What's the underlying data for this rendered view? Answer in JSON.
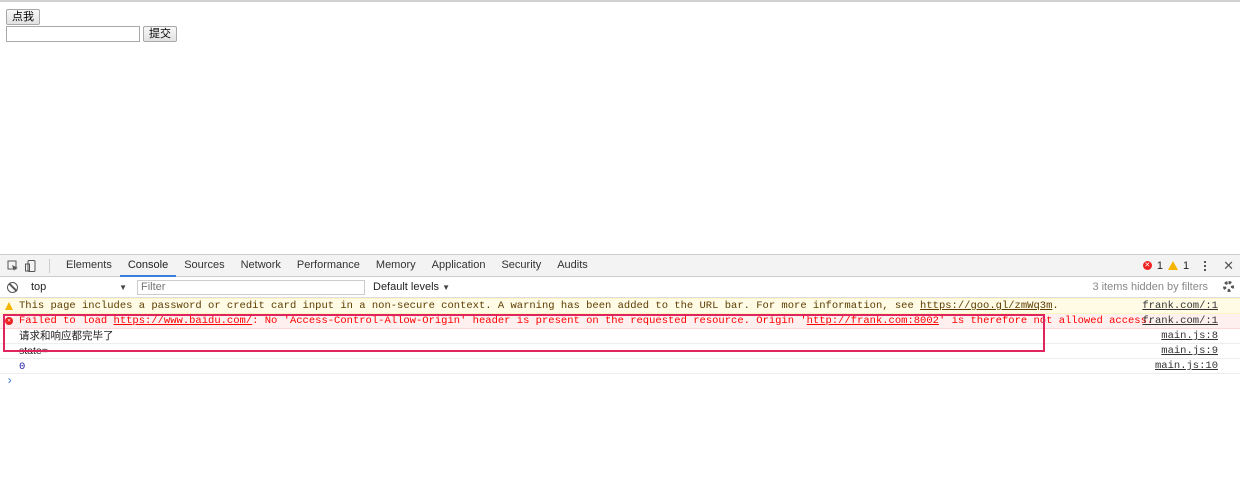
{
  "page": {
    "click_button": "点我",
    "text_input_value": "",
    "submit_button": "提交"
  },
  "devtools": {
    "tabs": [
      "Elements",
      "Console",
      "Sources",
      "Network",
      "Performance",
      "Memory",
      "Application",
      "Security",
      "Audits"
    ],
    "active_tab": "Console",
    "error_count": "1",
    "warning_count": "1",
    "context": "top",
    "filter_placeholder": "Filter",
    "levels": "Default levels",
    "hidden_note": "3 items hidden by filters"
  },
  "console": {
    "warn": {
      "text_before": "This page includes a password or credit card input in a non-secure context. A warning has been added to the URL bar. For more information, see ",
      "link": "https://goo.gl/zmWq3m",
      "text_after": ".",
      "source": "frank.com/:1"
    },
    "error": {
      "text1": "Failed to load ",
      "link1": "https://www.baidu.com/",
      "text2": ": No 'Access-Control-Allow-Origin' header is present on the requested resource. Origin '",
      "link2": "http://frank.com:8002",
      "text3": "' is therefore not allowed access.",
      "source": "frank.com/:1"
    },
    "log1": {
      "text": "请求和响应都完毕了",
      "source": "main.js:8"
    },
    "log2": {
      "text": "state=",
      "source": "main.js:9"
    },
    "log3": {
      "text": "0",
      "source": "main.js:10"
    },
    "prompt": "›"
  },
  "colors": {
    "error": "#ff0000",
    "warning": "#f4b400",
    "highlight": "#e0245e",
    "active_tab": "#3b7ddd"
  }
}
